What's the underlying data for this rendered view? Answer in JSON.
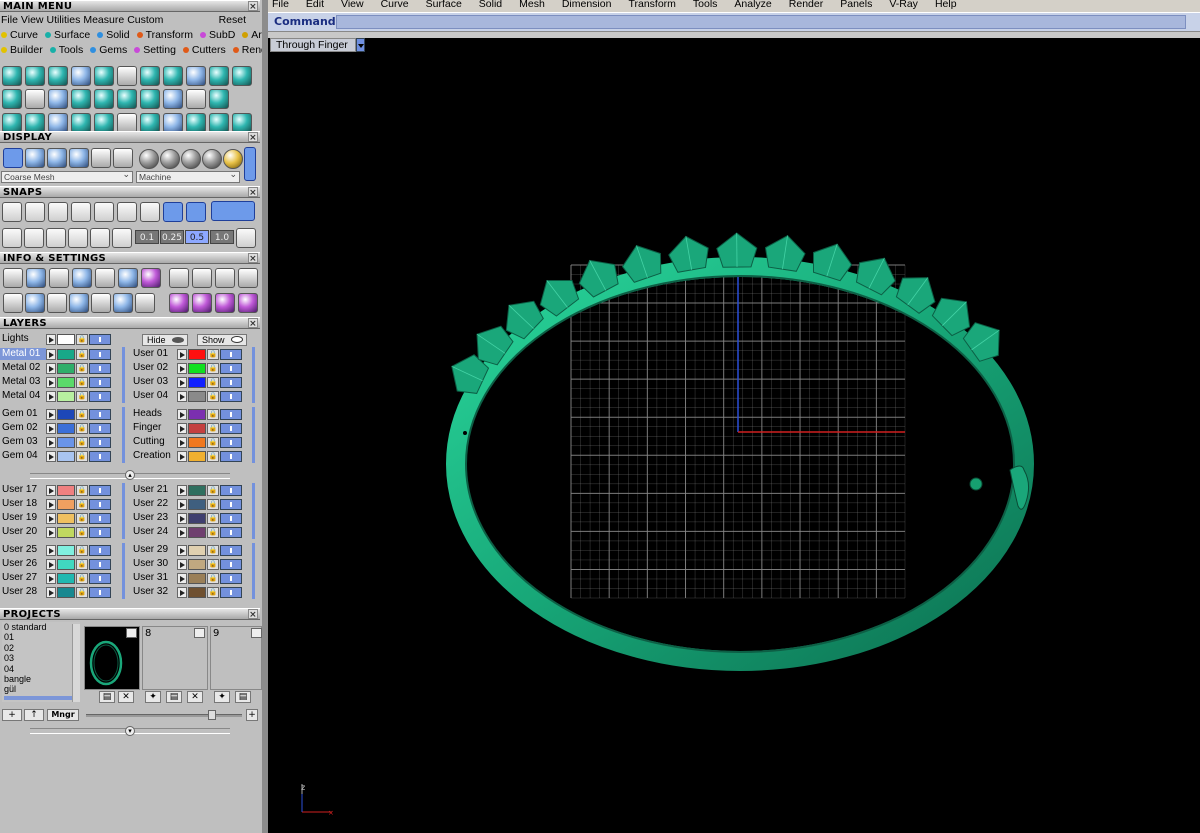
{
  "main_menu": {
    "title": "MAIN MENU",
    "menu_items": [
      "File",
      "View",
      "Utilities",
      "Measure",
      "Custom"
    ],
    "reset": "Reset",
    "row1": [
      {
        "label": "Curve",
        "color": "#e2c200"
      },
      {
        "label": "Surface",
        "color": "#18b0a8"
      },
      {
        "label": "Solid",
        "color": "#2f8fe0"
      },
      {
        "label": "Transform",
        "color": "#e05a18"
      },
      {
        "label": "SubD",
        "color": "#c84ad8"
      },
      {
        "label": "Art",
        "color": "#d0a000"
      }
    ],
    "row2": [
      {
        "label": "Builder",
        "color": "#e2c200"
      },
      {
        "label": "Tools",
        "color": "#18b0a8"
      },
      {
        "label": "Gems",
        "color": "#2f8fe0"
      },
      {
        "label": "Setting",
        "color": "#c84ad8"
      },
      {
        "label": "Cutters",
        "color": "#e05a18"
      },
      {
        "label": "Render",
        "color": "#e05a18"
      }
    ]
  },
  "display": {
    "title": "DISPLAY",
    "mesh_mode": "Coarse Mesh",
    "material": "Machine"
  },
  "snaps": {
    "title": "SNAPS",
    "steps": [
      "0.1",
      "0.25",
      "0.5",
      "1.0"
    ],
    "active_step": "0.5"
  },
  "info_settings": {
    "title": "INFO & SETTINGS"
  },
  "layers": {
    "title": "LAYERS",
    "lights": "Lights",
    "hide": "Hide",
    "show": "Show",
    "groups": [
      {
        "left": [
          {
            "name": "Metal 01",
            "color": "#18a888",
            "selected": true
          },
          {
            "name": "Metal 02",
            "color": "#2fae6a"
          },
          {
            "name": "Metal 03",
            "color": "#5ad96a"
          },
          {
            "name": "Metal 04",
            "color": "#b8f0a0"
          }
        ],
        "right": [
          {
            "name": "User 01",
            "color": "#ff1010"
          },
          {
            "name": "User 02",
            "color": "#10e020"
          },
          {
            "name": "User 03",
            "color": "#1020ff"
          },
          {
            "name": "User 04",
            "color": "#8a8a8a"
          }
        ]
      },
      {
        "left": [
          {
            "name": "Gem 01",
            "color": "#1d47b8"
          },
          {
            "name": "Gem 02",
            "color": "#3b6fd8"
          },
          {
            "name": "Gem 03",
            "color": "#6a94e8"
          },
          {
            "name": "Gem 04",
            "color": "#a9c4f0"
          }
        ],
        "right": [
          {
            "name": "Heads",
            "color": "#7b2fb0"
          },
          {
            "name": "Finger",
            "color": "#c44040"
          },
          {
            "name": "Cutting",
            "color": "#f07820"
          },
          {
            "name": "Creation",
            "color": "#f0b030"
          }
        ]
      },
      {
        "left": [
          {
            "name": "User 17",
            "color": "#f08080"
          },
          {
            "name": "User 18",
            "color": "#f0a060"
          },
          {
            "name": "User 19",
            "color": "#f0c060"
          },
          {
            "name": "User 20",
            "color": "#c0d860"
          }
        ],
        "right": [
          {
            "name": "User 21",
            "color": "#2f6f5f"
          },
          {
            "name": "User 22",
            "color": "#3f5f7f"
          },
          {
            "name": "User 23",
            "color": "#3f3f6f"
          },
          {
            "name": "User 24",
            "color": "#6f3f6f"
          }
        ]
      },
      {
        "left": [
          {
            "name": "User 25",
            "color": "#80f0e0"
          },
          {
            "name": "User 26",
            "color": "#40d8c0"
          },
          {
            "name": "User 27",
            "color": "#20b8b0"
          },
          {
            "name": "User 28",
            "color": "#188890"
          }
        ],
        "right": [
          {
            "name": "User 29",
            "color": "#e0d0b0"
          },
          {
            "name": "User 30",
            "color": "#c0a880"
          },
          {
            "name": "User 31",
            "color": "#9a7f58"
          },
          {
            "name": "User 32",
            "color": "#6f5030"
          }
        ]
      }
    ]
  },
  "projects": {
    "title": "PROJECTS",
    "items": [
      "0 standard",
      "01",
      "02",
      "03",
      "04",
      "bangle",
      "gül"
    ],
    "slots": [
      "",
      "8",
      "9"
    ],
    "manager": "Mngr"
  },
  "menubar": [
    "File",
    "Edit",
    "View",
    "Curve",
    "Surface",
    "Solid",
    "Mesh",
    "Dimension",
    "Transform",
    "Tools",
    "Analyze",
    "Render",
    "Panels",
    "V-Ray",
    "Help"
  ],
  "command": {
    "label": "Command:",
    "value": ""
  },
  "viewport": {
    "view_name": "Through Finger",
    "axis_label": "z",
    "model_color": "#1aa77a",
    "grid_color": "#888888"
  }
}
